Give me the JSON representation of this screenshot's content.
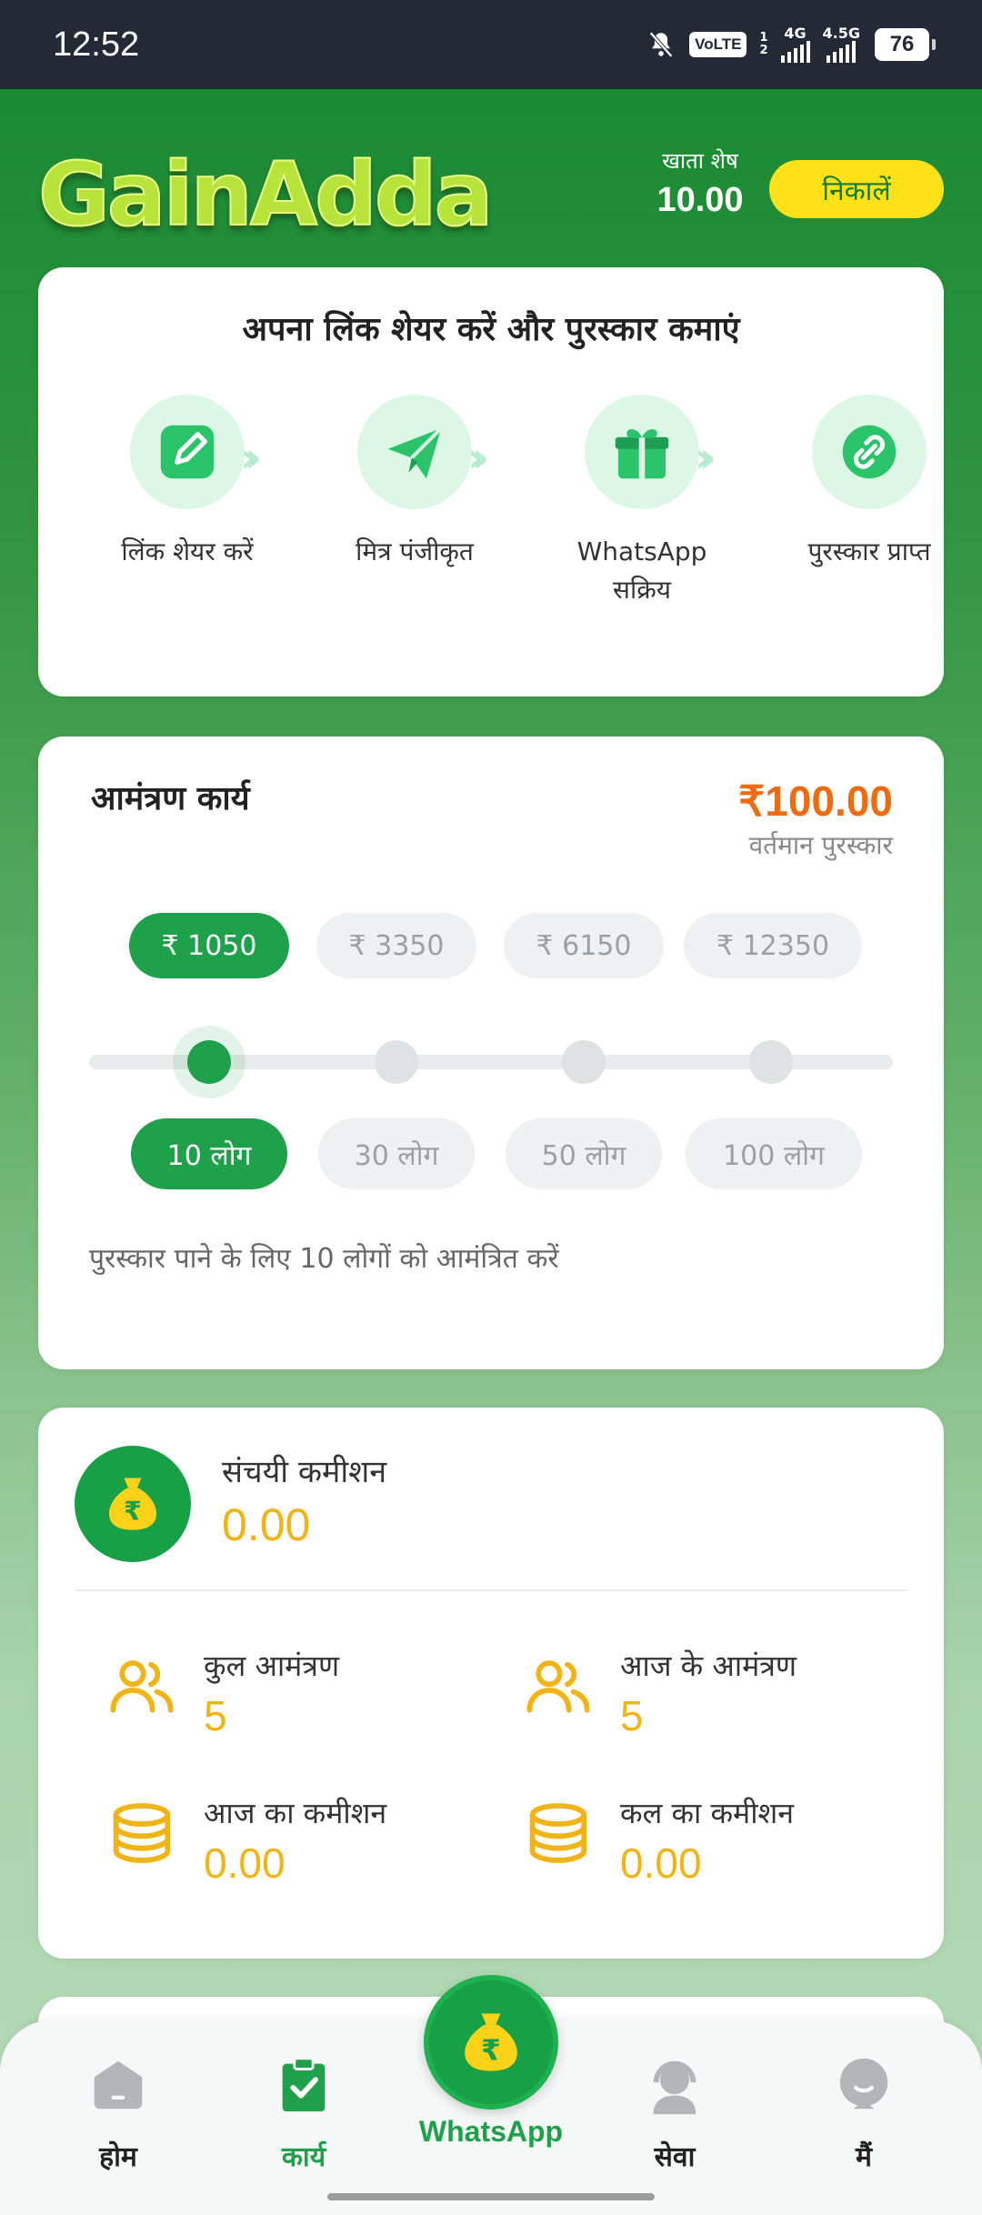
{
  "status_bar": {
    "time": "12:52",
    "volte": "VoLTE",
    "sim": "1\n2",
    "net1": "4G",
    "net2": "4.5G",
    "battery": "76"
  },
  "header": {
    "logo": "GainAdda",
    "balance_label": "खाता शेष",
    "balance_value": "10.00",
    "withdraw_label": "निकालें"
  },
  "share_card": {
    "title": "अपना लिंक शेयर करें और पुरस्कार कमाएं",
    "steps": [
      {
        "label": "लिंक शेयर करें",
        "icon": "edit-icon"
      },
      {
        "label": "मित्र पंजीकृत",
        "icon": "paper-plane-icon"
      },
      {
        "label": "WhatsApp\nसक्रिय",
        "icon": "gift-icon"
      },
      {
        "label": "पुरस्कार प्राप्त",
        "icon": "link-icon"
      }
    ]
  },
  "task_card": {
    "title": "आमंत्रण कार्य",
    "reward_value": "₹100.00",
    "reward_label": "वर्तमान पुरस्कार",
    "amounts": [
      "₹ 1050",
      "₹ 3350",
      "₹ 6150",
      "₹ 12350"
    ],
    "people": [
      "10 लोग",
      "30 लोग",
      "50 लोग",
      "100 लोग"
    ],
    "selected_index": 0,
    "hint": "पुरस्कार पाने के लिए 10 लोगों को आमंत्रित करें"
  },
  "commission_card": {
    "label": "संचयी कमीशन",
    "value": "0.00",
    "stats": [
      {
        "label": "कुल आमंत्रण",
        "value": "5",
        "icon": "users-icon"
      },
      {
        "label": "आज के आमंत्रण",
        "value": "5",
        "icon": "users-icon"
      },
      {
        "label": "आज का कमीशन",
        "value": "0.00",
        "icon": "coins-icon"
      },
      {
        "label": "कल का कमीशन",
        "value": "0.00",
        "icon": "coins-icon"
      }
    ]
  },
  "bottom_nav": {
    "items": [
      {
        "label": "होम",
        "icon": "home-icon"
      },
      {
        "label": "कार्य",
        "icon": "task-clipboard-icon"
      },
      {
        "label": "WhatsApp",
        "icon": "money-bag-icon"
      },
      {
        "label": "सेवा",
        "icon": "support-agent-icon"
      },
      {
        "label": "मैं",
        "icon": "profile-icon"
      }
    ],
    "active_index": 1
  },
  "colors": {
    "brand_green": "#1fa04b",
    "accent_yellow": "#ffe21a",
    "reward_orange": "#ef6b12",
    "stat_gold": "#f0b416"
  }
}
